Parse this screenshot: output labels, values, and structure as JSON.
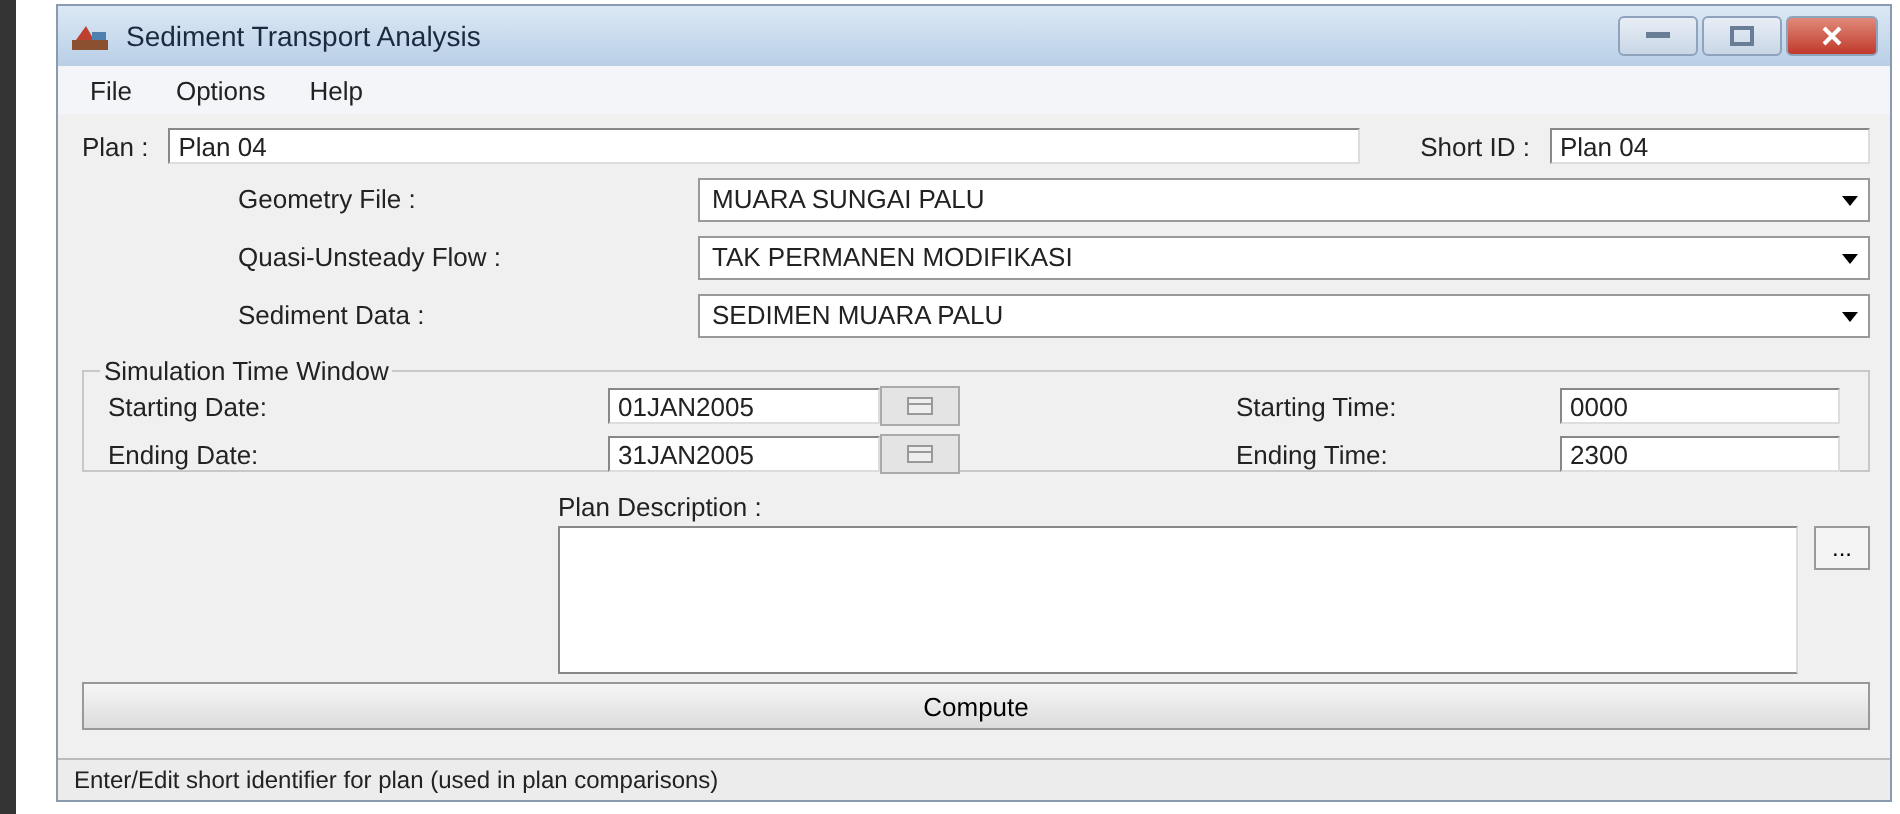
{
  "window": {
    "title": "Sediment Transport Analysis"
  },
  "menu": [
    "File",
    "Options",
    "Help"
  ],
  "plan": {
    "label": "Plan :",
    "value": "Plan 04",
    "short_id_label": "Short ID :",
    "short_id": "Plan 04"
  },
  "selectors": [
    {
      "label": "Geometry File :",
      "value": "MUARA SUNGAI PALU"
    },
    {
      "label": "Quasi-Unsteady Flow :",
      "value": "TAK PERMANEN MODIFIKASI"
    },
    {
      "label": "Sediment Data :",
      "value": "SEDIMEN MUARA PALU"
    }
  ],
  "time_window": {
    "title": "Simulation Time Window",
    "dates": [
      {
        "label": "Starting Date:",
        "value": "01JAN2005"
      },
      {
        "label": "Ending Date:",
        "value": "31JAN2005"
      }
    ],
    "times": [
      {
        "label": "Starting Time:",
        "value": "0000"
      },
      {
        "label": "Ending Time:",
        "value": "2300"
      }
    ]
  },
  "description": {
    "label": "Plan Description :",
    "button": "..."
  },
  "compute_button": "Compute",
  "status_bar": "Enter/Edit short identifier for plan (used in plan comparisons)"
}
